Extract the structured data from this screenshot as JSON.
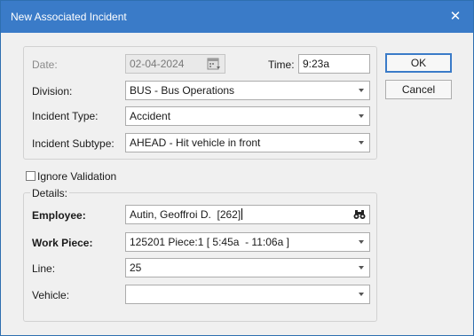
{
  "window": {
    "title": "New Associated Incident",
    "close_glyph": "✕"
  },
  "buttons": {
    "ok": "OK",
    "cancel": "Cancel"
  },
  "top_group": {
    "date_label": "Date:",
    "date_value": "02-04-2024",
    "time_label": "Time:",
    "time_value": "9:23a",
    "division_label": "Division:",
    "division_value": "BUS - Bus Operations",
    "incident_type_label": "Incident Type:",
    "incident_type_value": "Accident",
    "incident_subtype_label": "Incident Subtype:",
    "incident_subtype_value": "AHEAD - Hit vehicle in front"
  },
  "ignore_validation": {
    "label": "Ignore Validation",
    "checked": false
  },
  "details": {
    "legend": "Details:",
    "employee_label": "Employee:",
    "employee_value": "Autin, Geoffroi D.  [262]",
    "work_piece_label": "Work Piece:",
    "work_piece_value": "125201 Piece:1 [ 5:45a  - 11:06a ]",
    "line_label": "Line:",
    "line_value": "25",
    "vehicle_label": "Vehicle:",
    "vehicle_value": ""
  },
  "icons": {
    "close": "close-icon",
    "calendar": "calendar-icon",
    "search": "binoculars-icon",
    "dropdown": "chevron-down-icon"
  }
}
